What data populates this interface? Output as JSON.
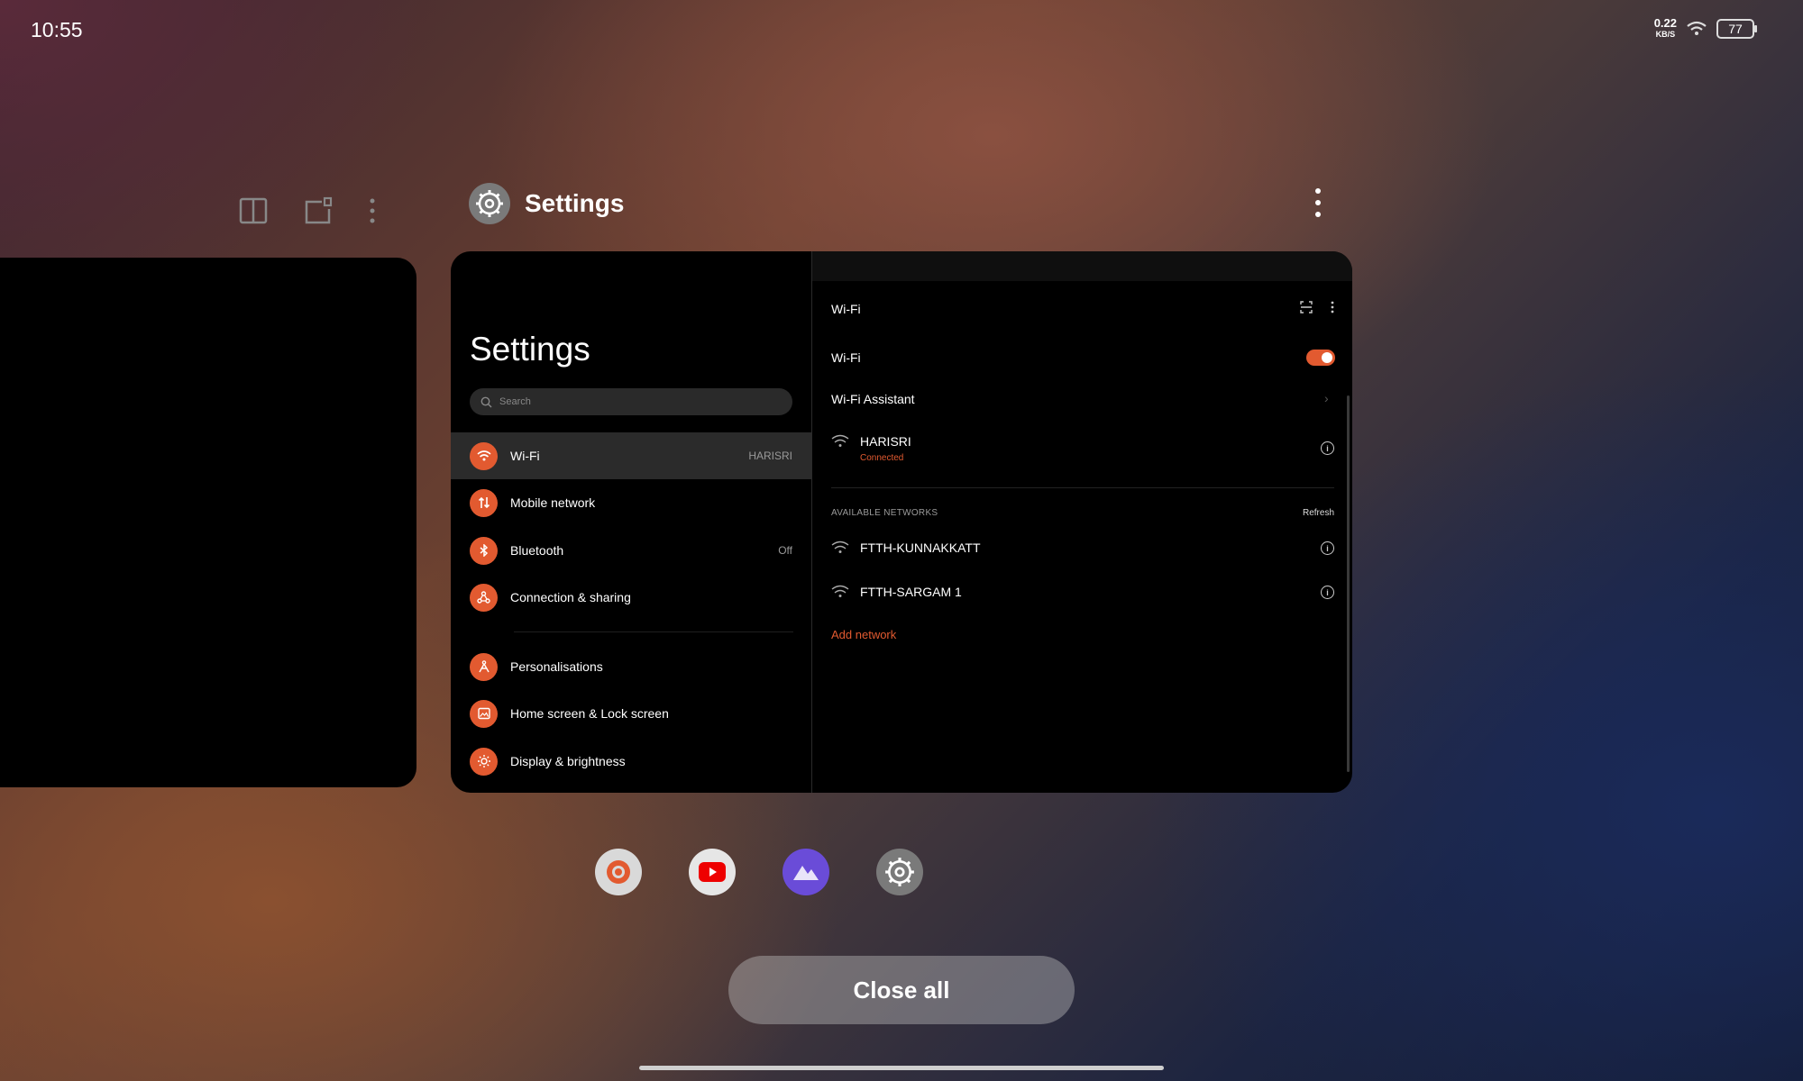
{
  "status_bar": {
    "time": "10:55",
    "net_speed_value": "0.22",
    "net_speed_unit": "KB/S",
    "battery": "77"
  },
  "recents_toolbar": {
    "split_icon": "split-screen-icon",
    "float_icon": "floating-window-icon",
    "more_icon": "more-vertical-icon"
  },
  "app_card": {
    "app_name": "Settings",
    "left_panel": {
      "title": "Settings",
      "search_placeholder": "Search",
      "items": [
        {
          "label": "Wi-Fi",
          "value": "HARISRI",
          "icon": "wifi-icon"
        },
        {
          "label": "Mobile network",
          "value": "",
          "icon": "mobile-data-icon"
        },
        {
          "label": "Bluetooth",
          "value": "Off",
          "icon": "bluetooth-icon"
        },
        {
          "label": "Connection & sharing",
          "value": "",
          "icon": "sharing-icon"
        },
        {
          "label": "Personalisations",
          "value": "",
          "icon": "personalisation-icon"
        },
        {
          "label": "Home screen & Lock screen",
          "value": "",
          "icon": "wallpaper-icon"
        },
        {
          "label": "Display & brightness",
          "value": "",
          "icon": "brightness-icon"
        }
      ]
    },
    "right_panel": {
      "header": "Wi-Fi",
      "wifi_toggle_label": "Wi-Fi",
      "wifi_enabled": true,
      "wifi_assistant_label": "Wi-Fi Assistant",
      "connected_network": {
        "name": "HARISRI",
        "status": "Connected"
      },
      "available_header": "AVAILABLE NETWORKS",
      "refresh_label": "Refresh",
      "networks": [
        {
          "name": "FTTH-KUNNAKKATT"
        },
        {
          "name": "FTTH-SARGAM 1"
        }
      ],
      "add_network_label": "Add network"
    }
  },
  "dock": [
    {
      "app": "shield-app-icon"
    },
    {
      "app": "youtube-icon"
    },
    {
      "app": "gallery-icon"
    },
    {
      "app": "settings-icon"
    }
  ],
  "close_all_label": "Close all",
  "colors": {
    "accent": "#e25a30",
    "panel_bg": "#000000",
    "active_row": "#2b2b2b"
  }
}
